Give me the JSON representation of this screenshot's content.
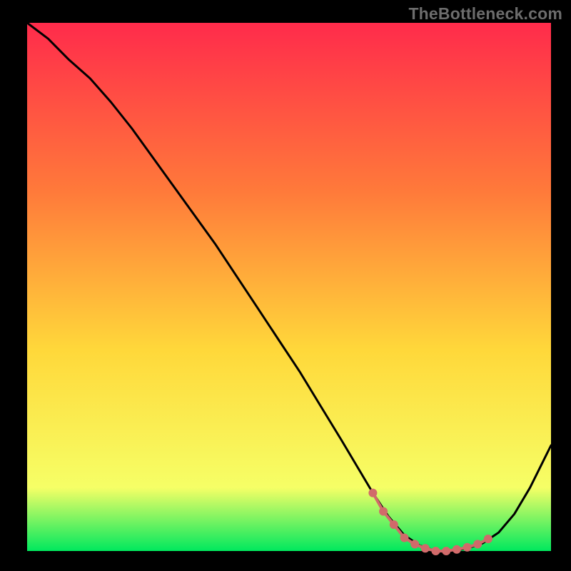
{
  "watermark": "TheBottleneck.com",
  "chart_data": {
    "type": "line",
    "title": "",
    "xlabel": "",
    "ylabel": "",
    "xlim": [
      0,
      100
    ],
    "ylim": [
      0,
      100
    ],
    "background_gradient": {
      "top": "#ff2b4b",
      "mid_upper": "#ff7a3a",
      "mid": "#ffd83a",
      "mid_lower": "#f6ff66",
      "bottom": "#00e85e"
    },
    "series": [
      {
        "name": "bottleneck-curve",
        "color": "#000000",
        "x": [
          0,
          4,
          8,
          12,
          16,
          20,
          24,
          28,
          32,
          36,
          40,
          44,
          48,
          52,
          56,
          60,
          63,
          66,
          69,
          72,
          75,
          78,
          81,
          84,
          87,
          90,
          93,
          96,
          100
        ],
        "values": [
          100,
          97,
          93,
          89.5,
          85,
          80,
          74.5,
          69,
          63.5,
          58,
          52,
          46,
          40,
          34,
          27.5,
          21,
          16,
          11,
          6.5,
          3,
          1,
          0,
          0,
          0.5,
          1.5,
          3.5,
          7,
          12,
          20
        ]
      }
    ],
    "highlight": {
      "name": "optimal-range",
      "color": "#d16a6a",
      "points_x": [
        66,
        68,
        70,
        72,
        74,
        76,
        78,
        80,
        82,
        84,
        86,
        88
      ],
      "points_y": [
        11,
        7.5,
        5,
        2.5,
        1.3,
        0.5,
        0,
        0,
        0.3,
        0.7,
        1.3,
        2.3
      ]
    }
  }
}
